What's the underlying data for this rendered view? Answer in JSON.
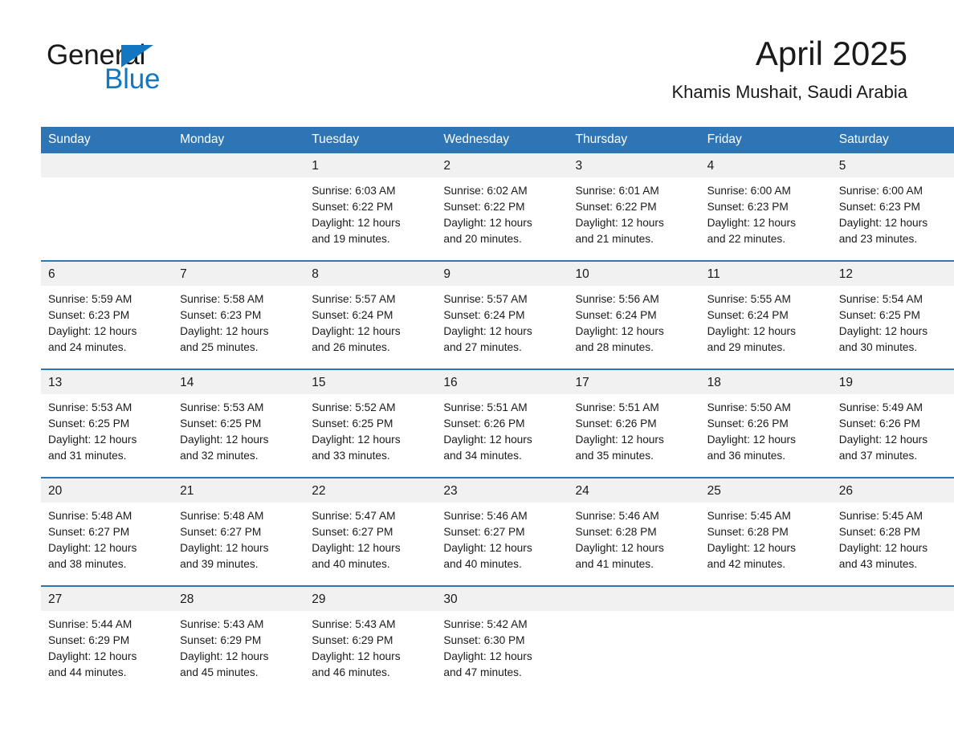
{
  "brand": {
    "name_part1": "General",
    "name_part2": "Blue",
    "colors": {
      "blue": "#1277c0",
      "header_blue": "#2e75b6",
      "day_band_gray": "#f1f1f1"
    }
  },
  "header": {
    "title": "April 2025",
    "subtitle": "Khamis Mushait, Saudi Arabia"
  },
  "calendar": {
    "weekday_headers": [
      "Sunday",
      "Monday",
      "Tuesday",
      "Wednesday",
      "Thursday",
      "Friday",
      "Saturday"
    ],
    "weeks": [
      [
        {
          "day": "",
          "info": ""
        },
        {
          "day": "",
          "info": ""
        },
        {
          "day": "1",
          "info": "Sunrise: 6:03 AM\nSunset: 6:22 PM\nDaylight: 12 hours\nand 19 minutes."
        },
        {
          "day": "2",
          "info": "Sunrise: 6:02 AM\nSunset: 6:22 PM\nDaylight: 12 hours\nand 20 minutes."
        },
        {
          "day": "3",
          "info": "Sunrise: 6:01 AM\nSunset: 6:22 PM\nDaylight: 12 hours\nand 21 minutes."
        },
        {
          "day": "4",
          "info": "Sunrise: 6:00 AM\nSunset: 6:23 PM\nDaylight: 12 hours\nand 22 minutes."
        },
        {
          "day": "5",
          "info": "Sunrise: 6:00 AM\nSunset: 6:23 PM\nDaylight: 12 hours\nand 23 minutes."
        }
      ],
      [
        {
          "day": "6",
          "info": "Sunrise: 5:59 AM\nSunset: 6:23 PM\nDaylight: 12 hours\nand 24 minutes."
        },
        {
          "day": "7",
          "info": "Sunrise: 5:58 AM\nSunset: 6:23 PM\nDaylight: 12 hours\nand 25 minutes."
        },
        {
          "day": "8",
          "info": "Sunrise: 5:57 AM\nSunset: 6:24 PM\nDaylight: 12 hours\nand 26 minutes."
        },
        {
          "day": "9",
          "info": "Sunrise: 5:57 AM\nSunset: 6:24 PM\nDaylight: 12 hours\nand 27 minutes."
        },
        {
          "day": "10",
          "info": "Sunrise: 5:56 AM\nSunset: 6:24 PM\nDaylight: 12 hours\nand 28 minutes."
        },
        {
          "day": "11",
          "info": "Sunrise: 5:55 AM\nSunset: 6:24 PM\nDaylight: 12 hours\nand 29 minutes."
        },
        {
          "day": "12",
          "info": "Sunrise: 5:54 AM\nSunset: 6:25 PM\nDaylight: 12 hours\nand 30 minutes."
        }
      ],
      [
        {
          "day": "13",
          "info": "Sunrise: 5:53 AM\nSunset: 6:25 PM\nDaylight: 12 hours\nand 31 minutes."
        },
        {
          "day": "14",
          "info": "Sunrise: 5:53 AM\nSunset: 6:25 PM\nDaylight: 12 hours\nand 32 minutes."
        },
        {
          "day": "15",
          "info": "Sunrise: 5:52 AM\nSunset: 6:25 PM\nDaylight: 12 hours\nand 33 minutes."
        },
        {
          "day": "16",
          "info": "Sunrise: 5:51 AM\nSunset: 6:26 PM\nDaylight: 12 hours\nand 34 minutes."
        },
        {
          "day": "17",
          "info": "Sunrise: 5:51 AM\nSunset: 6:26 PM\nDaylight: 12 hours\nand 35 minutes."
        },
        {
          "day": "18",
          "info": "Sunrise: 5:50 AM\nSunset: 6:26 PM\nDaylight: 12 hours\nand 36 minutes."
        },
        {
          "day": "19",
          "info": "Sunrise: 5:49 AM\nSunset: 6:26 PM\nDaylight: 12 hours\nand 37 minutes."
        }
      ],
      [
        {
          "day": "20",
          "info": "Sunrise: 5:48 AM\nSunset: 6:27 PM\nDaylight: 12 hours\nand 38 minutes."
        },
        {
          "day": "21",
          "info": "Sunrise: 5:48 AM\nSunset: 6:27 PM\nDaylight: 12 hours\nand 39 minutes."
        },
        {
          "day": "22",
          "info": "Sunrise: 5:47 AM\nSunset: 6:27 PM\nDaylight: 12 hours\nand 40 minutes."
        },
        {
          "day": "23",
          "info": "Sunrise: 5:46 AM\nSunset: 6:27 PM\nDaylight: 12 hours\nand 40 minutes."
        },
        {
          "day": "24",
          "info": "Sunrise: 5:46 AM\nSunset: 6:28 PM\nDaylight: 12 hours\nand 41 minutes."
        },
        {
          "day": "25",
          "info": "Sunrise: 5:45 AM\nSunset: 6:28 PM\nDaylight: 12 hours\nand 42 minutes."
        },
        {
          "day": "26",
          "info": "Sunrise: 5:45 AM\nSunset: 6:28 PM\nDaylight: 12 hours\nand 43 minutes."
        }
      ],
      [
        {
          "day": "27",
          "info": "Sunrise: 5:44 AM\nSunset: 6:29 PM\nDaylight: 12 hours\nand 44 minutes."
        },
        {
          "day": "28",
          "info": "Sunrise: 5:43 AM\nSunset: 6:29 PM\nDaylight: 12 hours\nand 45 minutes."
        },
        {
          "day": "29",
          "info": "Sunrise: 5:43 AM\nSunset: 6:29 PM\nDaylight: 12 hours\nand 46 minutes."
        },
        {
          "day": "30",
          "info": "Sunrise: 5:42 AM\nSunset: 6:30 PM\nDaylight: 12 hours\nand 47 minutes."
        },
        {
          "day": "",
          "info": ""
        },
        {
          "day": "",
          "info": ""
        },
        {
          "day": "",
          "info": ""
        }
      ]
    ]
  }
}
